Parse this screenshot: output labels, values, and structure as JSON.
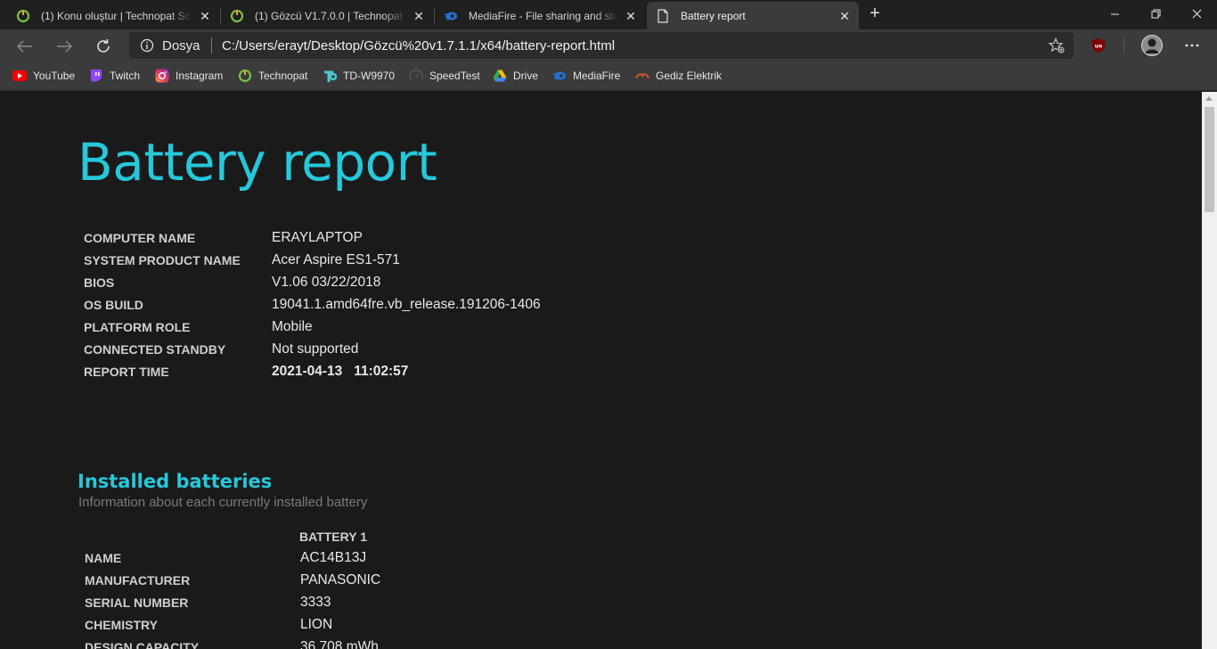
{
  "tabs": [
    {
      "title": "(1) Konu oluştur | Technopat Sosyal",
      "icon": "technopat-icon"
    },
    {
      "title": "(1) Gözcü V1.7.0.0 | Technopat Sosyal",
      "icon": "technopat-icon"
    },
    {
      "title": "MediaFire - File sharing and storage",
      "icon": "mediafire-icon"
    },
    {
      "title": "Battery report",
      "icon": "document-icon",
      "active": true
    }
  ],
  "address_bar": {
    "scheme_label": "Dosya",
    "url": "C:/Users/erayt/Desktop/Gözcü%20v1.7.1.1/x64/battery-report.html"
  },
  "bookmarks": [
    {
      "label": "YouTube",
      "icon": "youtube-icon"
    },
    {
      "label": "Twitch",
      "icon": "twitch-icon"
    },
    {
      "label": "Instagram",
      "icon": "instagram-icon"
    },
    {
      "label": "Technopat",
      "icon": "technopat-icon"
    },
    {
      "label": "TD-W9970",
      "icon": "tplink-icon"
    },
    {
      "label": "SpeedTest",
      "icon": "speedtest-icon"
    },
    {
      "label": "Drive",
      "icon": "drive-icon"
    },
    {
      "label": "MediaFire",
      "icon": "mediafire-icon"
    },
    {
      "label": "Gediz Elektrik",
      "icon": "gediz-icon"
    }
  ],
  "report": {
    "title": "Battery report",
    "system_info": [
      {
        "label": "COMPUTER NAME",
        "value": "ERAYLAPTOP"
      },
      {
        "label": "SYSTEM PRODUCT NAME",
        "value": "Acer Aspire ES1-571"
      },
      {
        "label": "BIOS",
        "value": "V1.06 03/22/2018"
      },
      {
        "label": "OS BUILD",
        "value": "19041.1.amd64fre.vb_release.191206-1406"
      },
      {
        "label": "PLATFORM ROLE",
        "value": "Mobile"
      },
      {
        "label": "CONNECTED STANDBY",
        "value": "Not supported"
      },
      {
        "label": "REPORT TIME",
        "value": "2021-04-13   11:02:57"
      }
    ],
    "installed_batteries": {
      "title": "Installed batteries",
      "subtitle": "Information about each currently installed battery",
      "column_header": "BATTERY 1",
      "rows": [
        {
          "label": "NAME",
          "value": "AC14B13J"
        },
        {
          "label": "MANUFACTURER",
          "value": "PANASONIC"
        },
        {
          "label": "SERIAL NUMBER",
          "value": "3333"
        },
        {
          "label": "CHEMISTRY",
          "value": "LION"
        },
        {
          "label": "DESIGN CAPACITY",
          "value": "36,708 mWh"
        }
      ]
    }
  },
  "colors": {
    "accent": "#26c8da",
    "page_bg": "#1a1a1a",
    "toolbar_bg": "#3b3b3b"
  }
}
